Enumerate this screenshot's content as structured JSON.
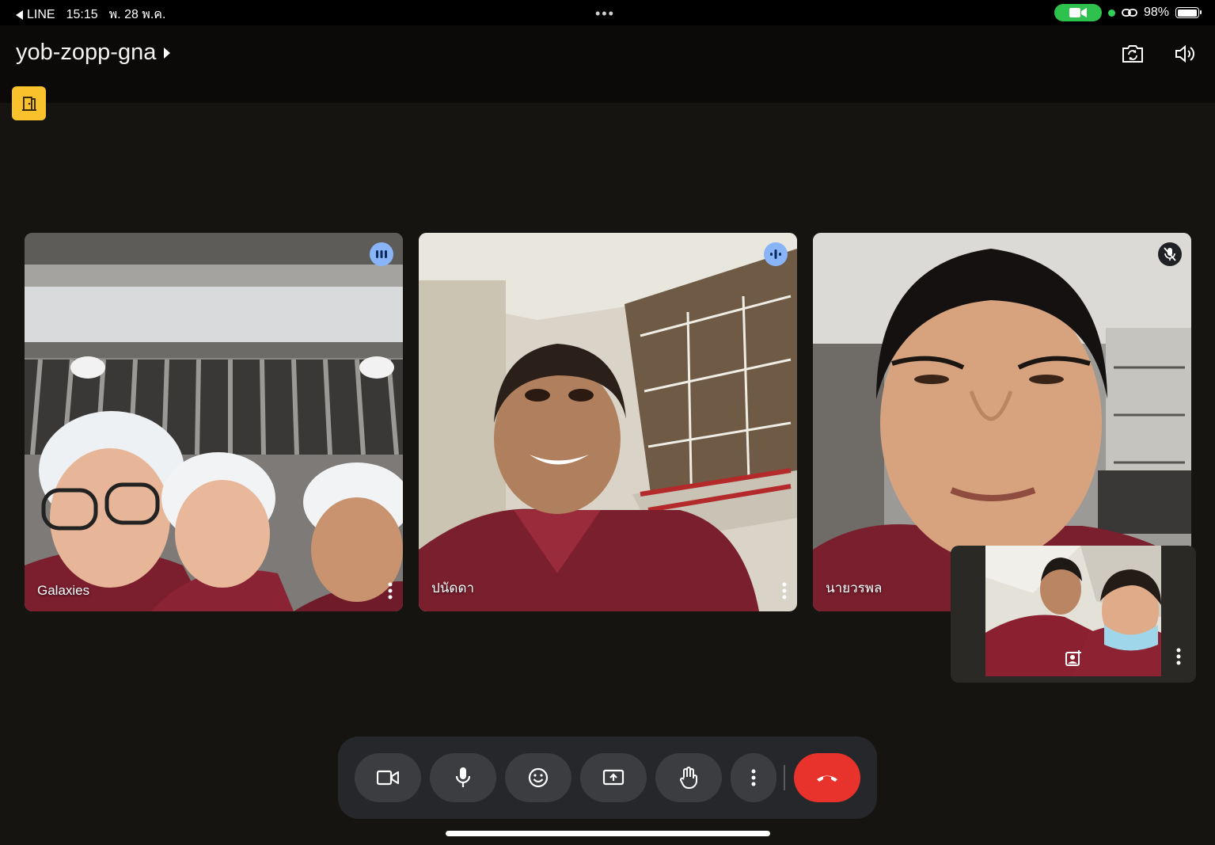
{
  "status_bar": {
    "back_app": "LINE",
    "time": "15:15",
    "date": "พ. 28 พ.ค.",
    "battery": "98%",
    "battery_level": 0.98
  },
  "meeting": {
    "code": "yob-zopp-gna"
  },
  "participants": [
    {
      "name": "Galaxies",
      "audio_state": "speaking"
    },
    {
      "name": "ปนัดดา",
      "audio_state": "speaking"
    },
    {
      "name": "นายวรพล",
      "audio_state": "muted"
    }
  ],
  "icons": {
    "back": "back-arrow-icon",
    "camera_in_use": "video-camera-icon",
    "hotspot": "link-icon",
    "switch_camera": "camera-switch-icon",
    "speaker": "speaker-icon",
    "leave_room": "door-icon",
    "camera_toggle": "camera-icon",
    "microphone": "microphone-icon",
    "reactions": "smiley-icon",
    "present": "present-screen-icon",
    "raise_hand": "hand-icon",
    "more": "more-vert-icon",
    "end_call": "phone-hangup-icon",
    "self_effects": "image-effect-icon"
  },
  "colors": {
    "background": "#151411",
    "speaking_badge": "#8ab4f8",
    "end_call": "#e8322c",
    "leave_badge": "#f9c22d",
    "camera_pill": "#2fc14e"
  }
}
